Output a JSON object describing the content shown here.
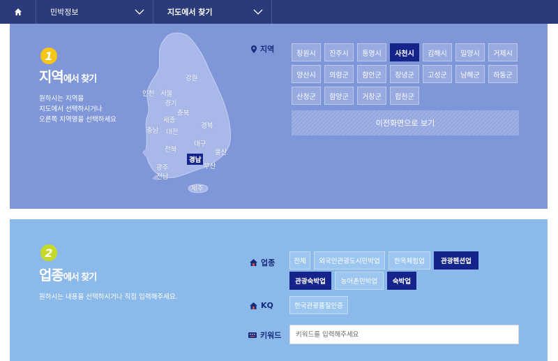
{
  "nav": {
    "dropdown1": "민박정보",
    "dropdown2": "지도에서 찾기"
  },
  "region_section": {
    "number": "1",
    "title_main": "지역",
    "title_sub": "에서 찾기",
    "desc": "원하시는 지역을\n지도에서 선택하시거나\n오른쪽 지역명을 선택하세요",
    "label": "지역",
    "map_labels": [
      "강원",
      "인천",
      "서울",
      "경기",
      "충북",
      "세종",
      "충남",
      "대전",
      "경북",
      "대구",
      "전북",
      "경남",
      "울산",
      "광주",
      "부산",
      "전남",
      "제주"
    ],
    "cities": [
      "창원시",
      "진주시",
      "통영시",
      "사천시",
      "김해시",
      "밀양시",
      "거제시",
      "양산시",
      "의령군",
      "함안군",
      "창녕군",
      "고성군",
      "남해군",
      "하동군",
      "산청군",
      "함양군",
      "거창군",
      "합천군"
    ],
    "selected_city": "사천시",
    "back_label": "이전화면으로 보기"
  },
  "industry_section": {
    "number": "2",
    "title_main": "업종",
    "title_sub": "에서 찾기",
    "desc": "원하시는 내용을 선택하시거나 직접 입력해주세요.",
    "industry_label": "업종",
    "industries": [
      "전체",
      "외국인관광도시민박업",
      "한옥체험업",
      "관광펜션업",
      "관광숙박업",
      "농어촌민박업",
      "숙박업"
    ],
    "selected_industries": [
      "관광펜션업",
      "관광숙박업",
      "숙박업"
    ],
    "kq_label": "KQ",
    "kq_option": "한국관광품질인증",
    "keyword_label": "키워드",
    "keyword_placeholder": "키워드를 입력해주세요"
  },
  "colors": {
    "nav_bg": "#2b3a78",
    "region_bg": "#7f97d8",
    "industry_bg": "#8ab9ea",
    "selected": "#15248a",
    "badge1": "#f5c518",
    "badge2": "#c6d92a"
  }
}
